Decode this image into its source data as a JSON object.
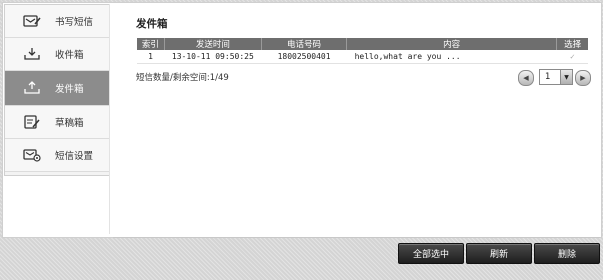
{
  "sidebar": {
    "items": [
      {
        "label": "书写短信",
        "icon": "compose-icon",
        "active": false
      },
      {
        "label": "收件箱",
        "icon": "inbox-icon",
        "active": false
      },
      {
        "label": "发件箱",
        "icon": "outbox-icon",
        "active": true
      },
      {
        "label": "草稿箱",
        "icon": "drafts-icon",
        "active": false
      },
      {
        "label": "短信设置",
        "icon": "sms-settings-icon",
        "active": false
      }
    ]
  },
  "main": {
    "title": "发件箱",
    "table": {
      "headers": [
        "索引",
        "发送时间",
        "电话号码",
        "内容",
        "选择"
      ],
      "rows": [
        {
          "index": "1",
          "time": "13-10-11 09:50:25",
          "phone": "18002500401",
          "content": "hello,what are you ...",
          "select": "✓"
        }
      ]
    },
    "status_text": "短信数量/剩余空间:1/49",
    "pager": {
      "current_page": "1"
    }
  },
  "actions": {
    "select_all": "全部选中",
    "refresh": "刷新",
    "delete": "删除"
  },
  "colors": {
    "header_bg": "#6e6e6e",
    "active_item_bg": "#8c8c8c",
    "button_bg": "#2a2a2a"
  }
}
